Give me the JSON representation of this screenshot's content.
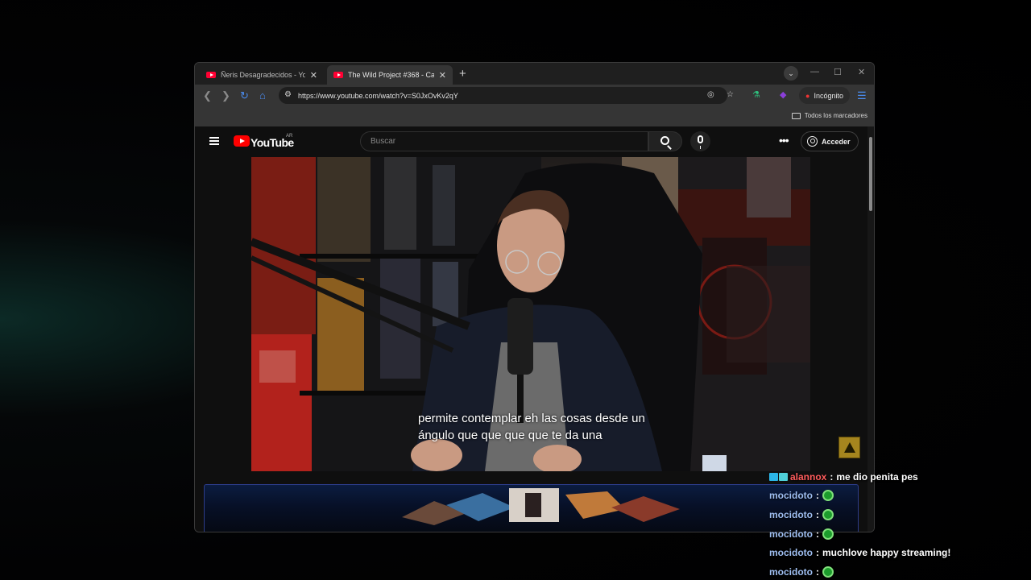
{
  "browser": {
    "tabs": [
      {
        "title": "Ñeris Desagradecidos - YouTube",
        "active": false
      },
      {
        "title": "The Wild Project #368 - Ca",
        "active": true
      }
    ],
    "new_tab": "+",
    "url": "https://www.youtube.com/watch?v=S0JxOvKv2qY",
    "incognito_label": "Incógnito",
    "bookmarks_label": "Todos los marcadores"
  },
  "youtube": {
    "logo_text": "YouTube",
    "country_code": "AR",
    "search_placeholder": "Buscar",
    "more_glyph": "•••",
    "sign_in_label": "Acceder",
    "subtitle_lines": [
      "permite contemplar eh las cosas desde un",
      "ángulo que que que que te da una"
    ]
  },
  "chat": [
    {
      "user": "alannox",
      "message": "me dio penita pes",
      "badges": true,
      "user_color": "#ff5c5c"
    },
    {
      "user": "mocidoto",
      "message": "",
      "emote": "emote-icon"
    },
    {
      "user": "mocidoto",
      "message": "",
      "emote": "emote-icon"
    },
    {
      "user": "mocidoto",
      "message": "",
      "emote": "emote-icon"
    },
    {
      "user": "mocidoto",
      "message": "muchlove happy streaming!"
    },
    {
      "user": "mocidoto",
      "message": "",
      "emote": "emote-icon"
    }
  ],
  "colors": {
    "youtube_red": "#ff0000",
    "accent_chat_user": "#9fbff2"
  }
}
